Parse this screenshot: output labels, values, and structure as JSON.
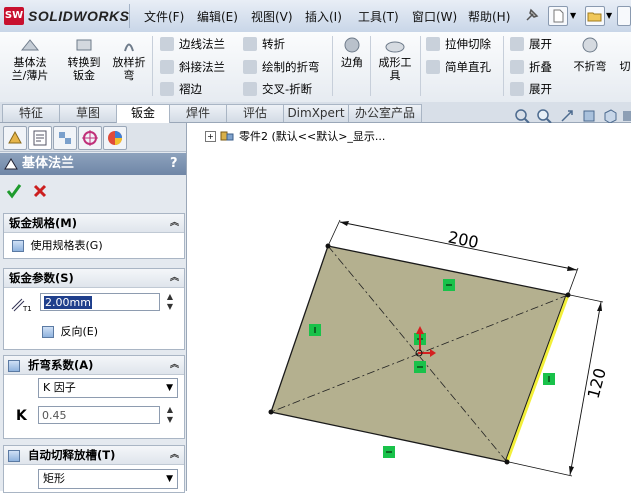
{
  "app": {
    "brand": "SOLIDWORKS",
    "logo_mark": "SW"
  },
  "menu": [
    "文件(F)",
    "编辑(E)",
    "视图(V)",
    "插入(I)",
    "工具(T)",
    "窗口(W)",
    "帮助(H)"
  ],
  "ribbon": {
    "big": [
      "基体法兰/薄片",
      "转换到钣金",
      "放样折弯",
      "边角",
      "成形工具",
      "不折弯",
      "切"
    ],
    "small": {
      "edge_flange": "边线法兰",
      "miter_flange": "斜接法兰",
      "hem": "褶边",
      "jog": "转折",
      "sketched_bend": "绘制的折弯",
      "cross_break": "交叉-折断",
      "extruded_cut": "拉伸切除",
      "simple_hole": "简单直孔",
      "unfold": "展开",
      "fold": "折叠",
      "flatten": "展开"
    }
  },
  "tabs": [
    {
      "label": "特征",
      "active": false
    },
    {
      "label": "草图",
      "active": false
    },
    {
      "label": "钣金",
      "active": true
    },
    {
      "label": "焊件",
      "active": false
    },
    {
      "label": "评估",
      "active": false
    },
    {
      "label": "DimXpert",
      "active": false
    },
    {
      "label": "办公室产品",
      "active": false
    }
  ],
  "tree": {
    "text": "零件2 (默认<<默认>_显示..."
  },
  "pm": {
    "title": "基体法兰",
    "help": "?",
    "gauge": {
      "title": "钣金规格(M)",
      "use_gauge_table": "使用规格表(G)"
    },
    "params": {
      "title": "钣金参数(S)",
      "thickness": "2.00mm",
      "reverse": "反向(E)"
    },
    "bend": {
      "title": "折弯系数(A)",
      "type": "K 因子",
      "k_label": "K",
      "k_value": "0.45"
    },
    "relief": {
      "title": "自动切释放槽(T)",
      "type": "矩形"
    }
  },
  "drawing": {
    "dim_width": "200",
    "dim_height": "120"
  },
  "colors": {
    "face": "#b4b08f",
    "highlight_edge": "#f2ef3a",
    "relation_marker": "#19c24a",
    "accent_red": "#d42020"
  }
}
